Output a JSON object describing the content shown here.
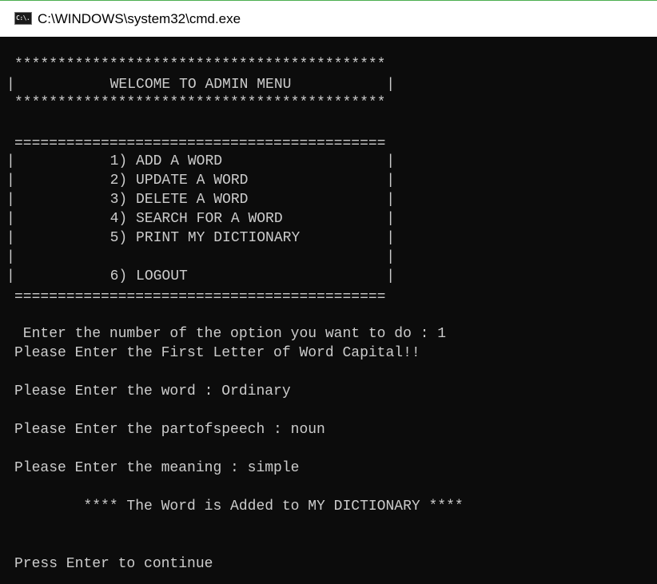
{
  "window": {
    "title": "C:\\WINDOWS\\system32\\cmd.exe",
    "icon_label": "C:\\."
  },
  "console": {
    "lines": [
      "*******************************************",
      "|           WELCOME TO ADMIN MENU           |",
      "*******************************************",
      "===========================================",
      "|           1) ADD A WORD                   |",
      "|           2) UPDATE A WORD                |",
      "|           3) DELETE A WORD                |",
      "|           4) SEARCH FOR A WORD            |",
      "|           5) PRINT MY DICTIONARY          |",
      "|                                           |",
      "|           6) LOGOUT                       |",
      "===========================================",
      " Enter the number of the option you want to do : 1",
      "Please Enter the First Letter of Word Capital!!",
      "Please Enter the word : Ordinary",
      "Please Enter the partofspeech : noun",
      "Please Enter the meaning : simple",
      "        **** The Word is Added to MY DICTIONARY ****",
      "Press Enter to continue"
    ]
  },
  "colors": {
    "console_bg": "#0c0c0c",
    "console_fg": "#cccccc",
    "titlebar_bg": "#ffffff"
  }
}
